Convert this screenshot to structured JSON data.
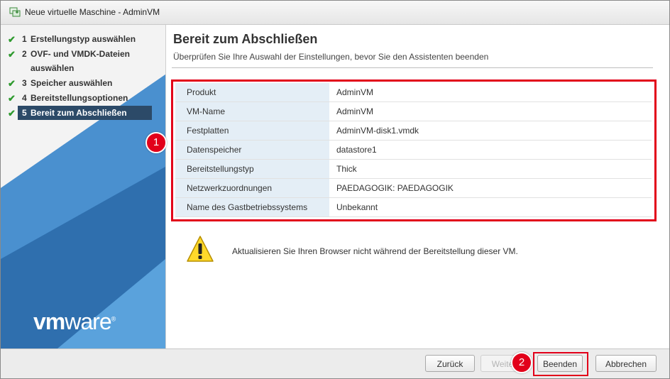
{
  "window": {
    "title": "Neue virtuelle Maschine - AdminVM"
  },
  "steps": [
    {
      "num": "1",
      "label": "Erstellungstyp auswählen",
      "done": true
    },
    {
      "num": "2",
      "label": "OVF- und VMDK-Dateien auswählen",
      "done": true
    },
    {
      "num": "3",
      "label": "Speicher auswählen",
      "done": true
    },
    {
      "num": "4",
      "label": "Bereitstellungsoptionen",
      "done": true
    },
    {
      "num": "5",
      "label": "Bereit zum Abschließen",
      "done": true,
      "active": true
    }
  ],
  "brand": {
    "logo_vm": "vm",
    "logo_rest": "ware",
    "logo_mark": "®"
  },
  "page": {
    "title": "Bereit zum Abschließen",
    "subtitle": "Überprüfen Sie Ihre Auswahl der Einstellungen, bevor Sie den Assistenten beenden"
  },
  "summary": [
    {
      "key": "Produkt",
      "value": "AdminVM"
    },
    {
      "key": "VM-Name",
      "value": "AdminVM"
    },
    {
      "key": "Festplatten",
      "value": "AdminVM-disk1.vmdk"
    },
    {
      "key": "Datenspeicher",
      "value": "datastore1"
    },
    {
      "key": "Bereitstellungstyp",
      "value": "Thick"
    },
    {
      "key": "Netzwerkzuordnungen",
      "value": "PAEDAGOGIK: PAEDAGOGIK"
    },
    {
      "key": "Name des Gastbetriebssystems",
      "value": "Unbekannt"
    }
  ],
  "warning": {
    "text": "Aktualisieren Sie Ihren Browser nicht während der Bereitstellung dieser VM."
  },
  "badges": {
    "one": "1",
    "two": "2"
  },
  "buttons": {
    "back": "Zurück",
    "next": "Weiter",
    "finish": "Beenden",
    "cancel": "Abbrechen"
  },
  "colors": {
    "accent_red": "#e2001a",
    "active_step": "#2c4a68",
    "check_green": "#2e9a2e",
    "sidebar_blue": "#3a7fc0"
  }
}
